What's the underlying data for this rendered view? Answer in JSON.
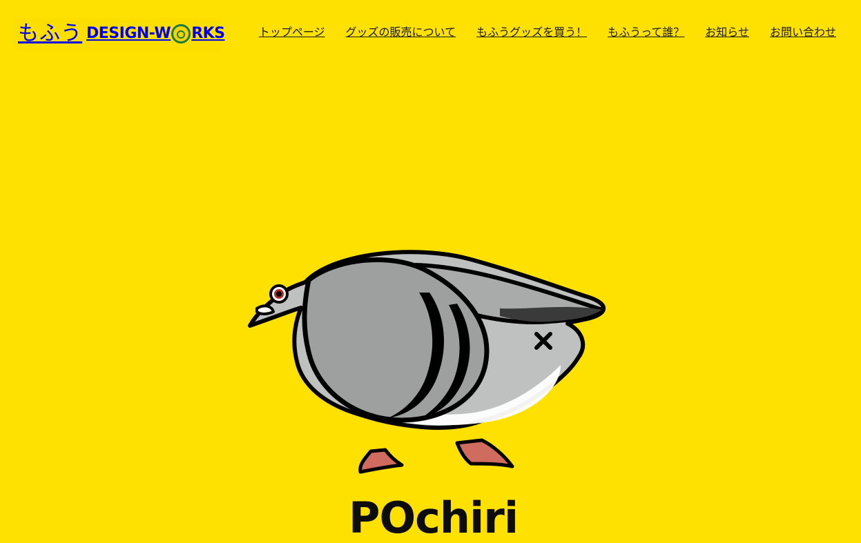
{
  "site": {
    "logo": {
      "jp_text": "もふう",
      "en_text_left": "DESIGN-W",
      "en_text_right": "RKS",
      "icon": "pineapple-o-icon",
      "colors": {
        "icon_ring": "#1C7C3A",
        "icon_fill": "#F7D300"
      }
    }
  },
  "nav": {
    "items": [
      {
        "label": "トップページ"
      },
      {
        "label": "グッズの販売について"
      },
      {
        "label": "もふうグッズを買う！"
      },
      {
        "label": "もふうって誰？"
      },
      {
        "label": "お知らせ"
      },
      {
        "label": "お問い合わせ"
      }
    ]
  },
  "hero": {
    "title": "POchiri",
    "image": {
      "subject": "pigeon-illustration",
      "mark": "×"
    },
    "background_color": "#FFE100"
  }
}
